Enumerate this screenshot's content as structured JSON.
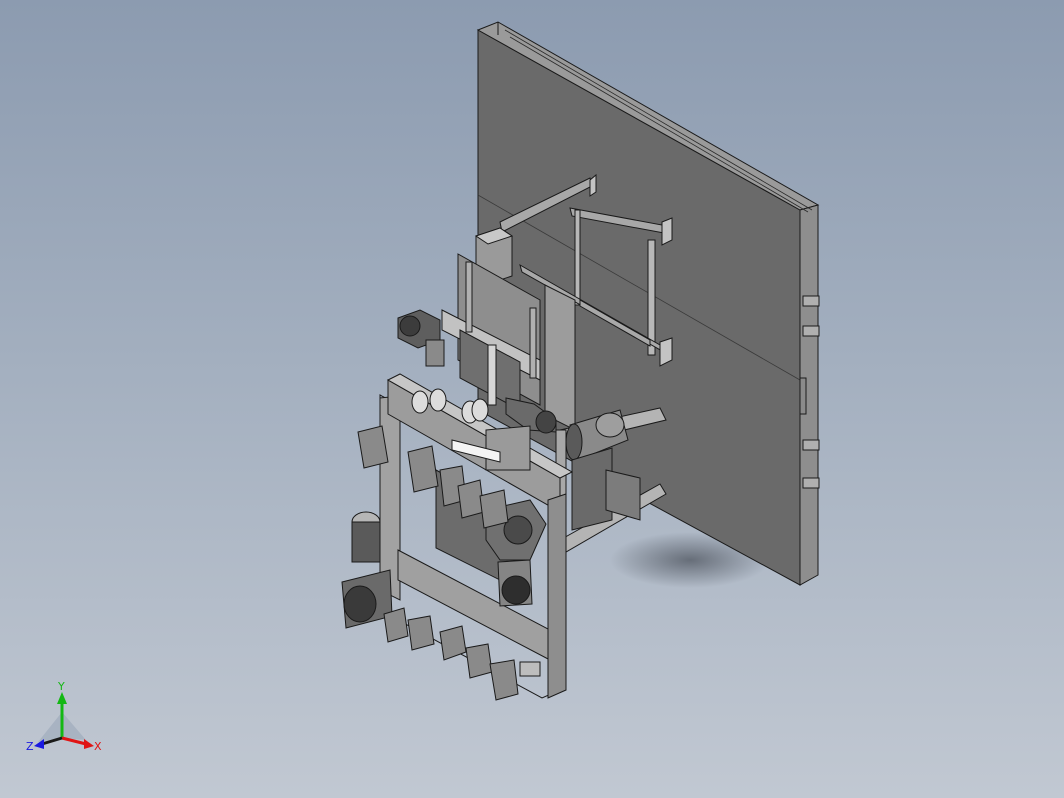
{
  "viewport": {
    "background_top": "#8c9bb0",
    "background_bottom": "#c1c8d2",
    "model_shade": "#6b6b6b",
    "edge_color": "#1a1a1a"
  },
  "triad": {
    "x_label": "X",
    "y_label": "Y",
    "z_label": "Z",
    "x_color": "#e01414",
    "y_color": "#14b814",
    "z_color": "#1a1ae0"
  }
}
